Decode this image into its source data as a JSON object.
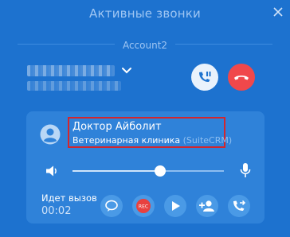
{
  "window": {
    "title": "Активные звонки",
    "close_icon": "close-icon"
  },
  "account": {
    "label": "Account2",
    "dropdown_icon": "chevron-down-icon"
  },
  "call_controls": {
    "hold_icon": "hold-icon",
    "hangup_icon": "hangup-icon"
  },
  "contact": {
    "name": "Доктор Айболит",
    "organization": "Ветеринарная клиника",
    "source": "(SuiteCRM)",
    "avatar_icon": "person-icon"
  },
  "volume": {
    "level": 0.58,
    "speaker_icon": "speaker-icon",
    "mic_icon": "microphone-icon"
  },
  "call_status": {
    "label": "Идет вызов",
    "timer": "00:02"
  },
  "actions": [
    {
      "name": "chat-button",
      "icon": "chat-bubble-icon"
    },
    {
      "name": "record-button",
      "icon": "record-icon",
      "text": "REC"
    },
    {
      "name": "play-button",
      "icon": "play-icon"
    },
    {
      "name": "add-participant-button",
      "icon": "add-user-icon"
    },
    {
      "name": "transfer-button",
      "icon": "transfer-call-icon"
    }
  ],
  "colors": {
    "background": "#1d72cf",
    "panel": "#2f82d9",
    "hangup": "#f0484b",
    "highlight_border": "#d3262d",
    "action_button": "#4a9ae6",
    "record": "#e8413f"
  }
}
